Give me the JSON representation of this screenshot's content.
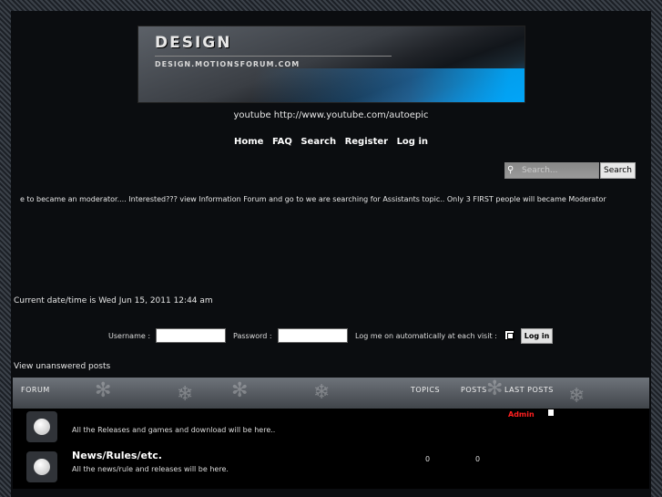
{
  "header": {
    "logo_title": "DESIGN",
    "logo_subtitle": "DESIGN.MOTIONSFORUM.COM",
    "description": "youtube http://www.youtube.com/autoepic"
  },
  "nav": {
    "items": [
      "Home",
      "FAQ",
      "Search",
      "Register",
      "Log in"
    ]
  },
  "search": {
    "placeholder": "Search...",
    "button": "Search"
  },
  "marquee": "e to became an moderator.... Interested??? view Information Forum and go to we are searching for Assistants topic.. Only 3 FIRST people will became Moderator",
  "datetime": "Current date/time is Wed Jun 15, 2011 12:44 am",
  "login": {
    "username_label": "Username :",
    "password_label": "Password :",
    "auto_label": "Log me on automatically at each visit :",
    "button": "Log in"
  },
  "unanswered": "View unanswered posts",
  "table": {
    "headers": {
      "forum": "FORUM",
      "topics": "TOPICS",
      "posts": "POSTS",
      "last": "LAST POSTS"
    },
    "rows": [
      {
        "title": "",
        "desc": "All the Releases and games and download will be here..",
        "topics": "",
        "posts": "",
        "last": "Admin"
      },
      {
        "title": "News/Rules/etc.",
        "desc": "All the news/rule and releases will be here.",
        "topics": "0",
        "posts": "0",
        "last": ""
      }
    ]
  },
  "colors": {
    "accent": "#0f72b4",
    "admin": "#ff2020"
  }
}
